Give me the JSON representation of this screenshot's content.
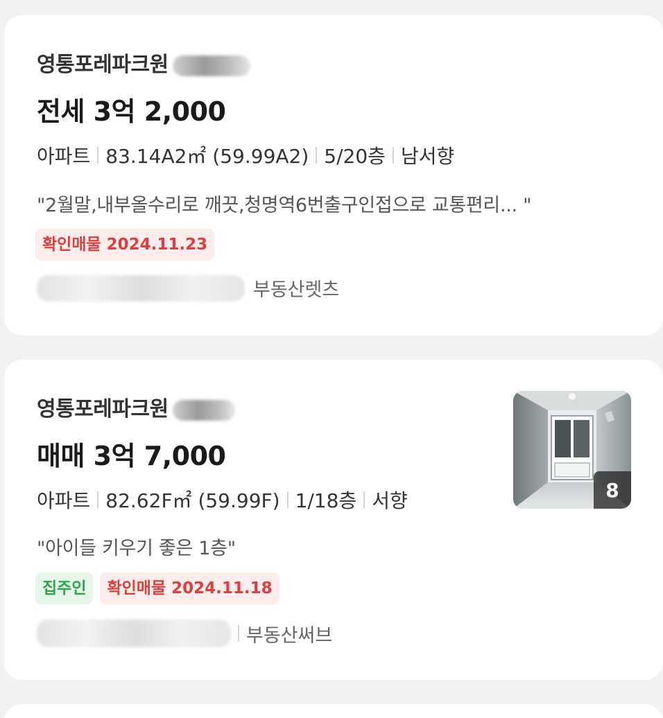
{
  "listings": [
    {
      "name": "영통포레파크원",
      "price": "전세 3억 2,000",
      "specs": {
        "type": "아파트",
        "area": "83.14A2㎡ (59.99A2)",
        "floor": "5/20층",
        "direction": "남서향"
      },
      "description": "\"2월말,내부올수리로 깨끗,청명역6번출구인접으로 교통편리...  \"",
      "tags": {
        "confirmed": "확인매물 2024.11.23"
      },
      "agent_suffix": "부동산렛츠"
    },
    {
      "name": "영통포레파크원",
      "price": "매매 3억 7,000",
      "specs": {
        "type": "아파트",
        "area": "82.62F㎡ (59.99F)",
        "floor": "1/18층",
        "direction": "서향"
      },
      "description": "\"아이들 키우기 좋은 1층\"",
      "tags": {
        "owner": "집주인",
        "confirmed": "확인매물 2024.11.18"
      },
      "agent_suffix": "부동산써브",
      "photo": {
        "count": "8"
      }
    }
  ],
  "icons": {
    "hallway_photo": "hallway-photo-thumbnail"
  },
  "colors": {
    "confirmed_tag_bg": "#fdecec",
    "confirmed_tag_text": "#d8413f",
    "owner_tag_bg": "#e6f6ea",
    "owner_tag_text": "#2fa451",
    "card_bg": "#ffffff",
    "page_bg": "#f1f2f4"
  }
}
